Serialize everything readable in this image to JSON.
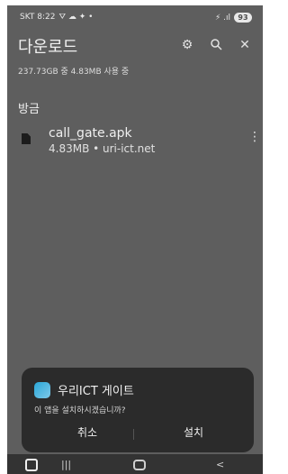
{
  "status_bar": {
    "carrier_time": "SKT 8:22",
    "icons_left": "⛛ ☁ ✦ •",
    "icons_right": "⚡ .ıl",
    "battery": "93"
  },
  "header": {
    "title": "다운로드"
  },
  "storage_info": "237.73GB 중 4.83MB 사용 중",
  "section": {
    "title": "방금"
  },
  "file": {
    "name": "call_gate.apk",
    "meta": "4.83MB • uri-ict.net"
  },
  "dialog": {
    "app_name": "우리ICT 게이트",
    "question": "이 앱을 설치하시겠습니까?",
    "cancel_label": "취소",
    "install_label": "설치"
  },
  "nav": {
    "recent": "|||",
    "back": "<"
  }
}
